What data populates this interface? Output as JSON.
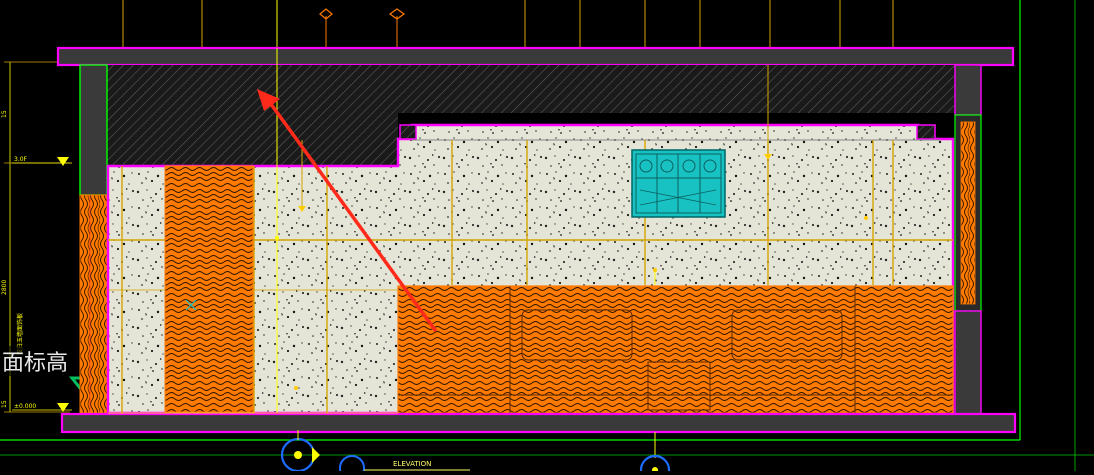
{
  "drawing": {
    "level_upper": "3.0F",
    "level_lower": "±0.000",
    "floor_label": "面标高",
    "elevation_title": "ELEVATION",
    "dim_upper": "15",
    "dim_middle": "2800",
    "dim_lower": "15",
    "vertical_note": "汉白玉墙面饰板"
  },
  "colors": {
    "background": "#000000",
    "frame": "#ff00ff",
    "structure": "#3a3a3a",
    "stone": "#e4e4d6",
    "wood": "#ff7a00",
    "glass": "#19c2c2",
    "grid": "#d4a400",
    "arrow": "#ff2a1a",
    "border": "#00ff00"
  }
}
